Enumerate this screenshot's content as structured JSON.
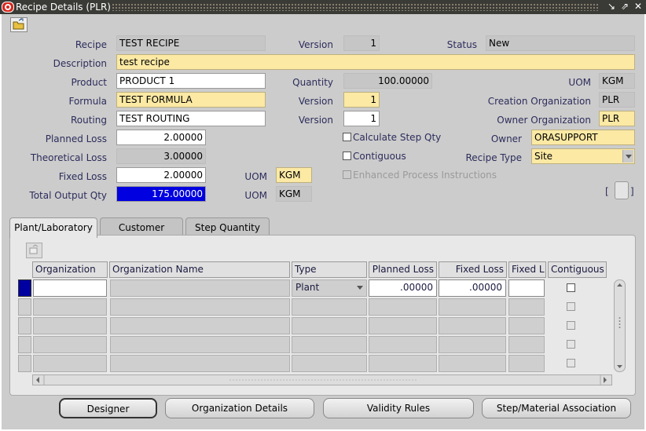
{
  "window": {
    "title": "Recipe Details (PLR)"
  },
  "header": {
    "recipe_label": "Recipe",
    "recipe_value": "TEST RECIPE",
    "version_label": "Version",
    "version_value": "1",
    "status_label": "Status",
    "status_value": "New",
    "description_label": "Description",
    "description_value": "test recipe",
    "product_label": "Product",
    "product_value": "PRODUCT 1",
    "quantity_label": "Quantity",
    "quantity_value": "100.00000",
    "uom_label": "UOM",
    "uom_value": "KGM",
    "formula_label": "Formula",
    "formula_value": "TEST FORMULA",
    "formula_version_label": "Version",
    "formula_version_value": "1",
    "creation_org_label": "Creation Organization",
    "creation_org_value": "PLR",
    "routing_label": "Routing",
    "routing_value": "TEST ROUTING",
    "routing_version_label": "Version",
    "routing_version_value": "1",
    "owner_org_label": "Owner Organization",
    "owner_org_value": "PLR",
    "planned_loss_label": "Planned Loss",
    "planned_loss_value": "2.00000",
    "calc_step_qty_label": "Calculate Step Qty",
    "owner_label": "Owner",
    "owner_value": "ORASUPPORT",
    "theoretical_loss_label": "Theoretical Loss",
    "theoretical_loss_value": "3.00000",
    "contiguous_label": "Contiguous",
    "recipe_type_label": "Recipe Type",
    "recipe_type_value": "Site",
    "fixed_loss_label": "Fixed Loss",
    "fixed_loss_value": "2.00000",
    "fixed_loss_uom_label": "UOM",
    "fixed_loss_uom_value": "KGM",
    "enhanced_label": "Enhanced Process Instructions",
    "total_output_label": "Total Output Qty",
    "total_output_value": "175.00000",
    "total_output_uom_label": "UOM",
    "total_output_uom_value": "KGM",
    "bracket_left": "[",
    "bracket_right": "]"
  },
  "tabs": [
    {
      "label": "Plant/Laboratory",
      "active": true
    },
    {
      "label": "Customer",
      "active": false
    },
    {
      "label": "Step Quantity",
      "active": false
    }
  ],
  "grid": {
    "columns": [
      "Organization",
      "Organization Name",
      "Type",
      "Planned Loss",
      "Fixed Loss",
      "Fixed L",
      "Contiguous"
    ],
    "rows": [
      {
        "organization": "",
        "organization_name": "",
        "type": "Plant",
        "planned_loss": ".00000",
        "fixed_loss": ".00000"
      },
      {
        "organization": "",
        "organization_name": "",
        "type": "",
        "planned_loss": "",
        "fixed_loss": ""
      },
      {
        "organization": "",
        "organization_name": "",
        "type": "",
        "planned_loss": "",
        "fixed_loss": ""
      },
      {
        "organization": "",
        "organization_name": "",
        "type": "",
        "planned_loss": "",
        "fixed_loss": ""
      },
      {
        "organization": "",
        "organization_name": "",
        "type": "",
        "planned_loss": "",
        "fixed_loss": ""
      }
    ]
  },
  "buttons": {
    "designer": "Designer",
    "organization_details": "Organization Details",
    "validity_rules": "Validity Rules",
    "step_material": "Step/Material Association"
  },
  "colors": {
    "title_bar": "#3a3a36",
    "required_field": "#fbe9a4",
    "selection": "#0000e0"
  },
  "icons": [
    "oracle-app-icon",
    "open-folder-icon",
    "minimize-icon",
    "restore-icon",
    "close-icon",
    "clear-record-icon"
  ]
}
